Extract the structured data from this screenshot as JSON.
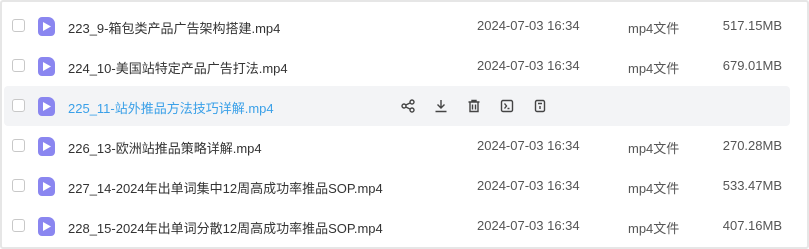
{
  "files": [
    {
      "name": "223_9-箱包类产品广告架构搭建.mp4",
      "date": "2024-07-03 16:34",
      "type": "mp4文件",
      "size": "517.15MB"
    },
    {
      "name": "224_10-美国站特定产品广告打法.mp4",
      "date": "2024-07-03 16:34",
      "type": "mp4文件",
      "size": "679.01MB"
    },
    {
      "name": "225_11-站外推品方法技巧详解.mp4",
      "date": "",
      "type": "",
      "size": ""
    },
    {
      "name": "226_13-欧洲站推品策略详解.mp4",
      "date": "2024-07-03 16:34",
      "type": "mp4文件",
      "size": "270.28MB"
    },
    {
      "name": "227_14-2024年出单词集中12周高成功率推品SOP.mp4",
      "date": "2024-07-03 16:34",
      "type": "mp4文件",
      "size": "533.47MB"
    },
    {
      "name": "228_15-2024年出单词分散12周高成功率推品SOP.mp4",
      "date": "2024-07-03 16:34",
      "type": "mp4文件",
      "size": "407.16MB"
    }
  ],
  "hover_actions": [
    "share-icon",
    "download-icon",
    "delete-icon",
    "rename-icon",
    "info-icon"
  ],
  "colors": {
    "file_icon": "#8a86f0",
    "hover_text": "#3aa0e8",
    "hover_bg": "#f3f4f6"
  }
}
